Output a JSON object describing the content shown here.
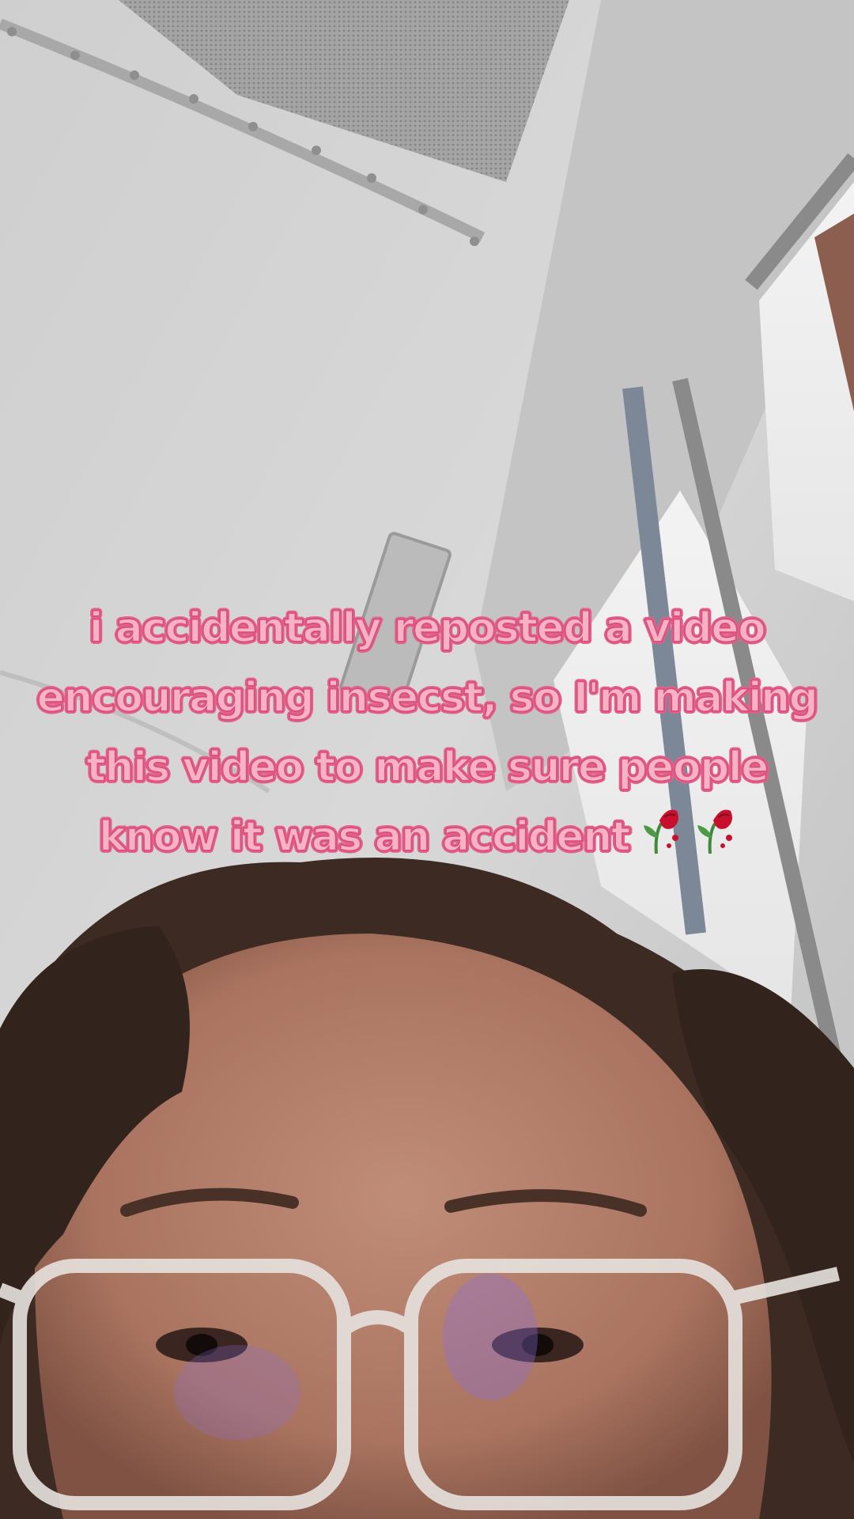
{
  "caption": {
    "lines": [
      "i accidentally reposted a video",
      "encouraging insecst, so I'm making",
      "this video to make sure people",
      "know it was an accident"
    ],
    "emoji": [
      "wilted-rose-icon",
      "wilted-rose-icon"
    ]
  },
  "colors": {
    "caption_fill": "#f7b2c6",
    "caption_outline": "#e3608b"
  }
}
